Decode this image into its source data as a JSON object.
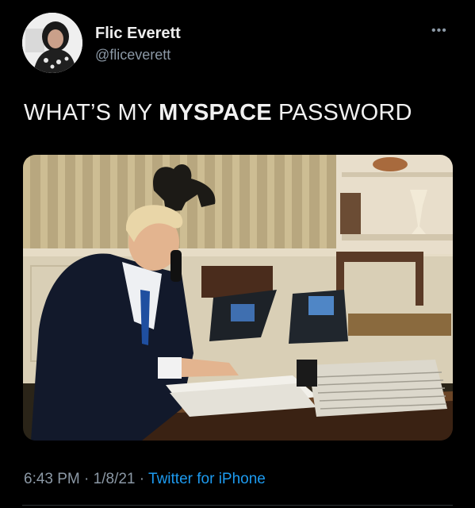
{
  "author": {
    "display_name": "Flic Everett",
    "handle": "@fliceverett"
  },
  "tweet": {
    "text_before": "WHAT’S MY ",
    "text_bold": "MYSPACE",
    "text_after": " PASSWORD"
  },
  "meta": {
    "time": "6:43 PM",
    "separator_1": " · ",
    "date": "1/8/21",
    "separator_2": " · ",
    "source": "Twitter for iPhone"
  },
  "icons": {
    "more": "more-options-icon"
  }
}
